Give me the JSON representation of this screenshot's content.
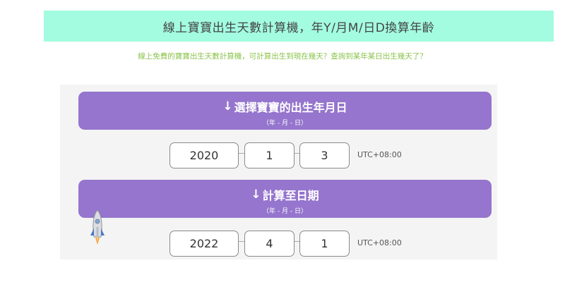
{
  "header": {
    "title": "線上寶寶出生天數計算機，年Y/月M/日D換算年齡",
    "subtitle": "線上免費的寶寶出生天數計算機，可計算出生到現在幾天？查詢到某年某日出生幾天了？"
  },
  "birth_section": {
    "arrow_icon": "↓",
    "title": "選擇寶寶的出生年月日",
    "format_hint": "（年 - 月 - 日）",
    "year": "2020",
    "month": "1",
    "day": "3",
    "timezone": "UTC+08:00"
  },
  "target_section": {
    "arrow_icon": "↓",
    "title": "計算至日期",
    "format_hint": "（年 - 月 - 日）",
    "year": "2022",
    "month": "4",
    "day": "1",
    "timezone": "UTC+08:00"
  },
  "colors": {
    "title_bar": "#a3fce0",
    "subtitle_text": "#8bc34a",
    "section_header": "#9575cd",
    "panel": "#f4f4f4"
  },
  "icons": {
    "scroll_to_top": "rocket-icon"
  }
}
